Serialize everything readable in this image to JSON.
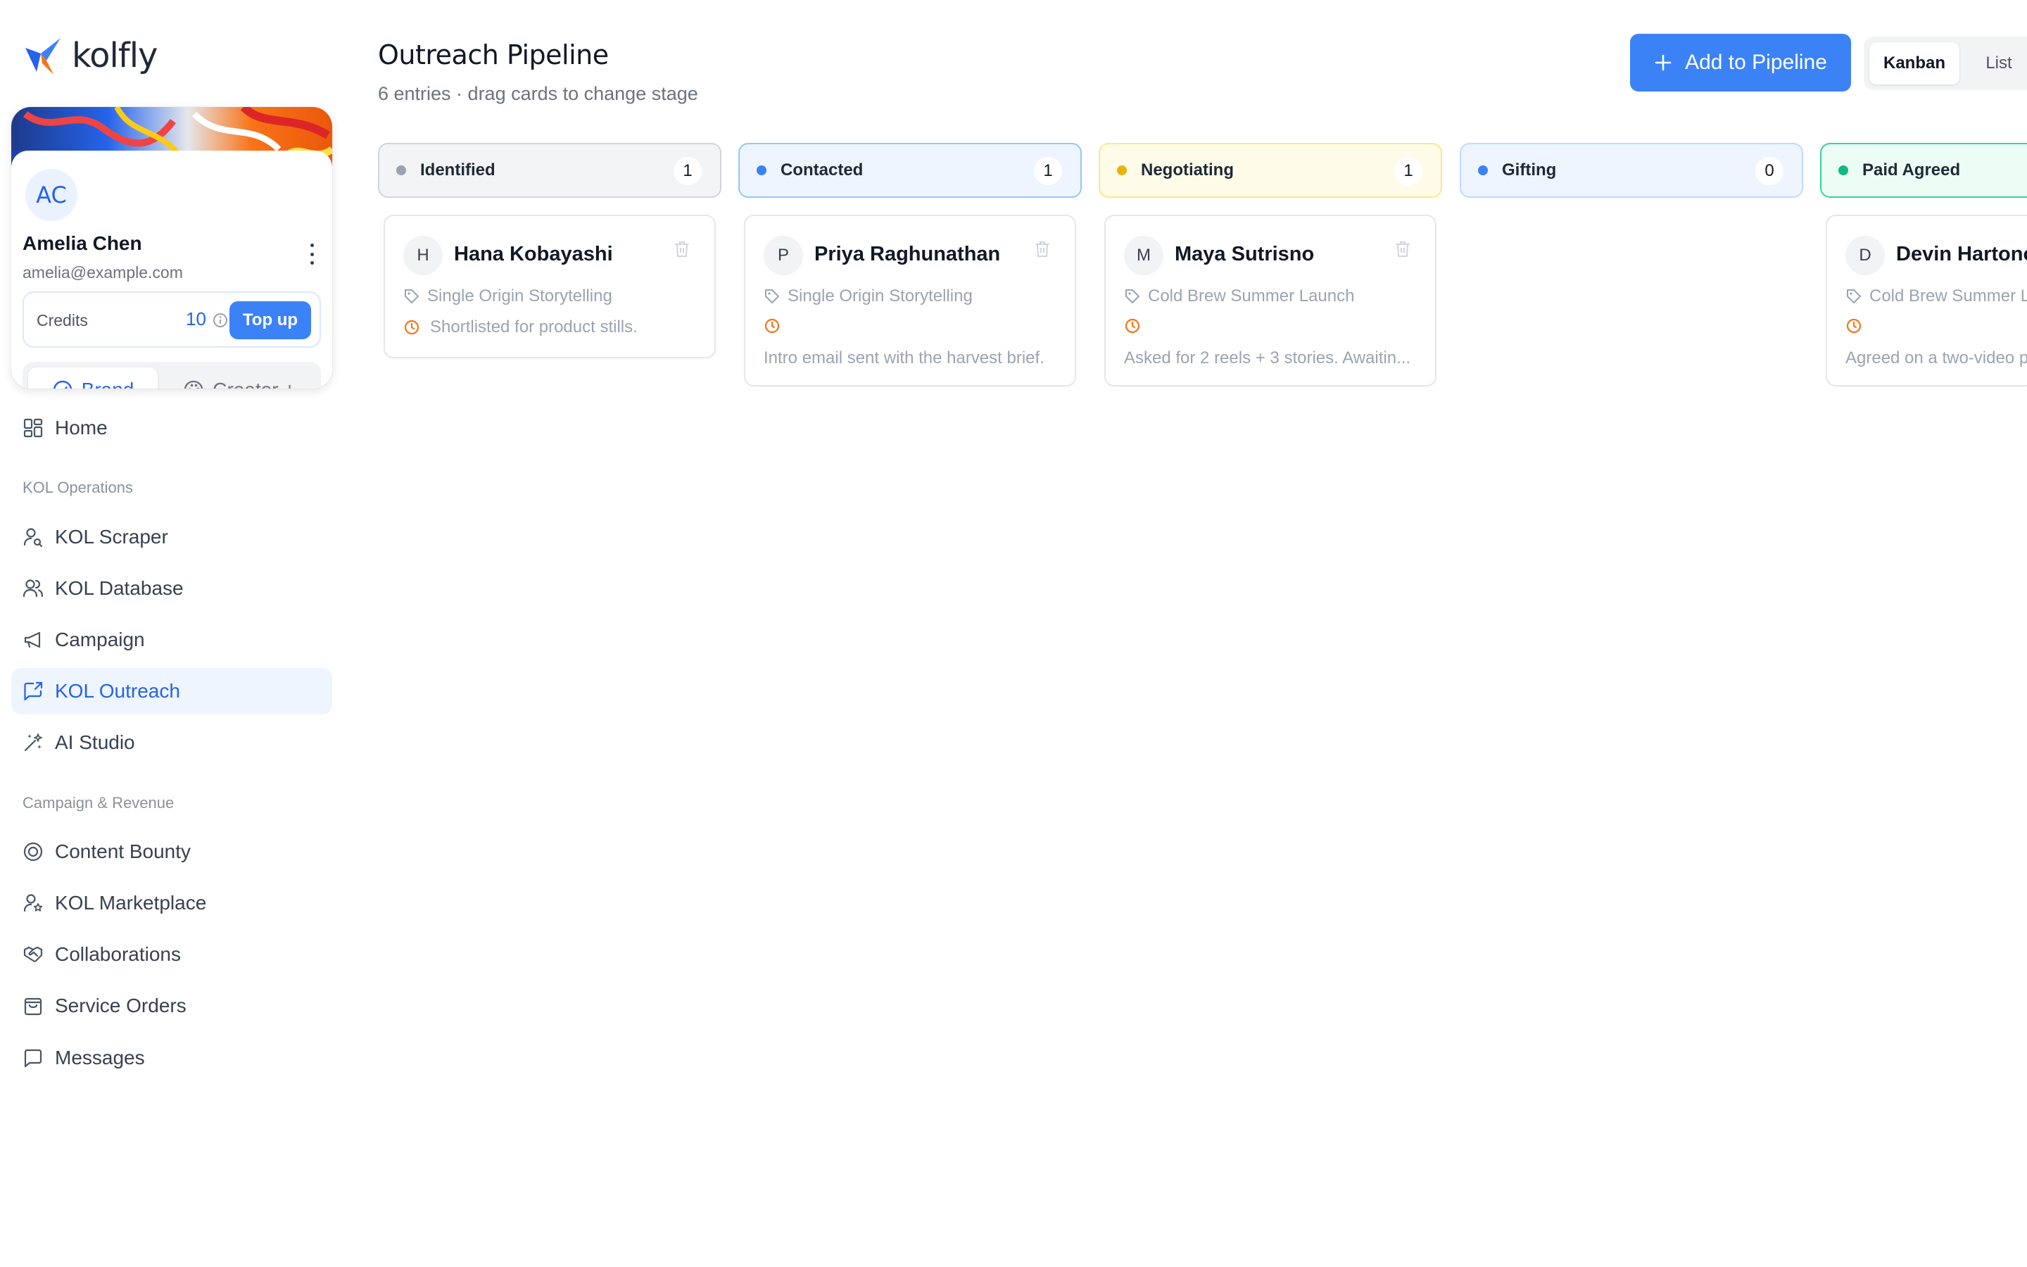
{
  "app": {
    "name": "kolfly",
    "brand_color": "#3b82f6"
  },
  "profile": {
    "initials": "AC",
    "name": "Amelia Chen",
    "email": "amelia@example.com",
    "credits_label": "Credits",
    "credits_value": "10",
    "topup_label": "Top up",
    "mode_brand_label": "Brand",
    "mode_creator_label": "Creator +"
  },
  "nav": {
    "home": "Home",
    "section_ops": "KOL Operations",
    "ops_items": [
      "KOL Scraper",
      "KOL Database",
      "Campaign",
      "KOL Outreach",
      "AI Studio"
    ],
    "section_rev": "Campaign & Revenue",
    "rev_items": [
      "Content Bounty",
      "KOL Marketplace",
      "Collaborations",
      "Service Orders",
      "Messages"
    ],
    "active": "KOL Outreach"
  },
  "header": {
    "title": "Outreach Pipeline",
    "subtitle": "6 entries · drag cards to change stage",
    "add_label": "Add to Pipeline",
    "view_kanban": "Kanban",
    "view_list": "List",
    "view_selected": "Kanban"
  },
  "columns": [
    {
      "title": "Identified",
      "count": "1",
      "dot": "#9ca3af",
      "bg": "#f3f4f6",
      "border": "#d1d5db"
    },
    {
      "title": "Contacted",
      "count": "1",
      "dot": "#3b82f6",
      "bg": "#eef5ff",
      "border": "#93c5fd"
    },
    {
      "title": "Negotiating",
      "count": "1",
      "dot": "#eab308",
      "bg": "#fefbe8",
      "border": "#fde68a"
    },
    {
      "title": "Gifting",
      "count": "0",
      "dot": "#3b82f6",
      "bg": "#eef5ff",
      "border": "#bfdbfe"
    },
    {
      "title": "Paid Agreed",
      "count": "",
      "dot": "#10b981",
      "bg": "#ecfdf5",
      "border": "#34d399"
    }
  ],
  "cards": [
    {
      "initial": "H",
      "name": "Hana Kobayashi",
      "campaign": "Single Origin Storytelling",
      "clock_text": "Shortlisted for product stills.",
      "note": ""
    },
    {
      "initial": "P",
      "name": "Priya Raghunathan",
      "campaign": "Single Origin Storytelling",
      "clock_text": "",
      "note": "Intro email sent with the harvest brief."
    },
    {
      "initial": "M",
      "name": "Maya Sutrisno",
      "campaign": "Cold Brew Summer Launch",
      "clock_text": "",
      "note": "Asked for 2 reels + 3 stories. Awaitin..."
    },
    {
      "initial": "D",
      "name": "Devin Hartono",
      "campaign": "Cold Brew Summer L",
      "clock_text": "",
      "note": "Agreed on a two-video p"
    }
  ]
}
